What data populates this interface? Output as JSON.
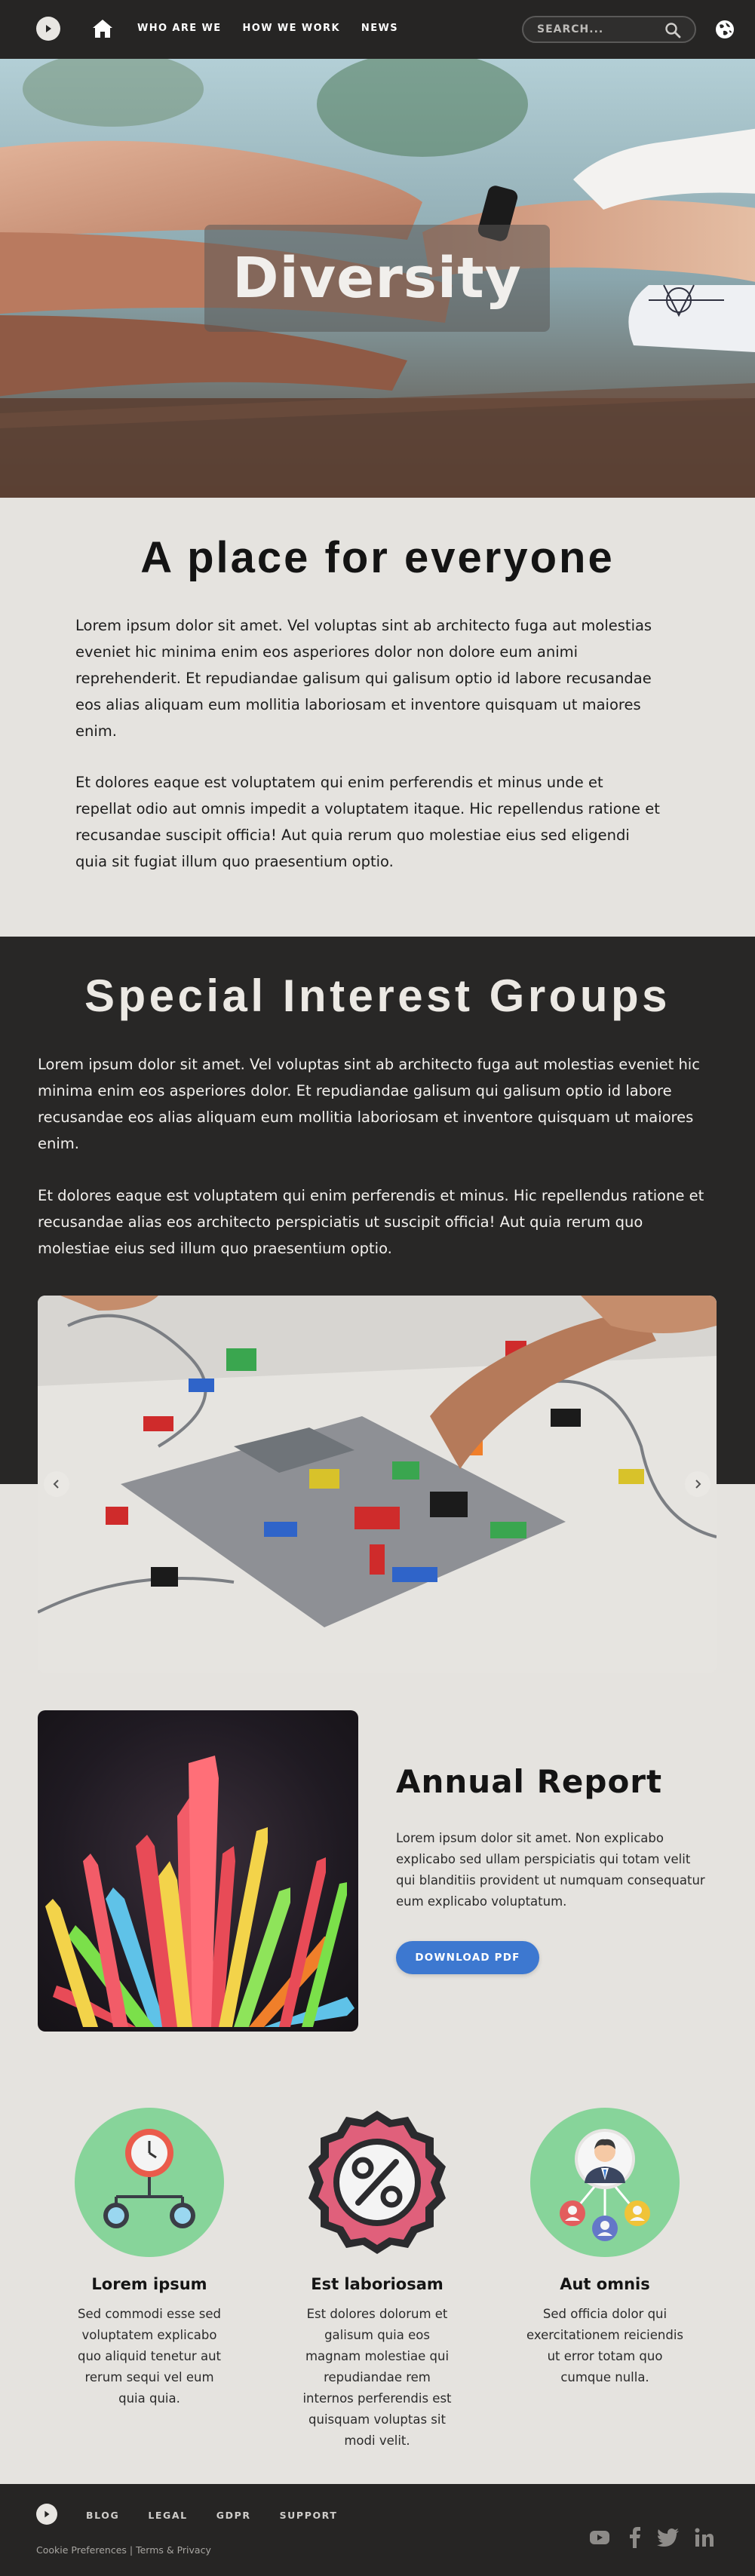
{
  "nav": {
    "links": [
      "WHO ARE WE",
      "HOW WE WORK",
      "NEWS"
    ],
    "search_placeholder": "SEARCH..."
  },
  "hero": {
    "title": "Diversity"
  },
  "intro": {
    "title": "A place for everyone",
    "p1": "Lorem ipsum dolor sit amet. Vel voluptas sint ab architecto fuga aut molestias eveniet hic minima enim eos asperiores dolor non dolore eum animi reprehenderit. Et repudiandae galisum qui galisum optio id labore recusandae eos alias aliquam eum mollitia laboriosam et inventore quisquam ut maiores enim.",
    "p2": "Et dolores eaque est voluptatem qui enim perferendis et minus unde et repellat odio aut omnis impedit a voluptatem itaque. Hic repellendus ratione et recusandae suscipit officia! Aut quia rerum quo molestiae eius sed eligendi quia sit fugiat illum quo praesentium optio."
  },
  "groups": {
    "title": "Special Interest Groups",
    "p1": "Lorem ipsum dolor sit amet. Vel voluptas sint ab architecto fuga aut molestias eveniet hic minima enim eos asperiores dolor. Et repudiandae galisum qui galisum optio id labore recusandae eos alias aliquam eum mollitia laboriosam et inventore quisquam ut maiores enim.",
    "p2": "Et dolores eaque est voluptatem qui enim perferendis et minus. Hic repellendus ratione et recusandae alias eos architecto perspiciatis ut suscipit officia! Aut quia rerum quo molestiae eius sed illum quo praesentium optio."
  },
  "report": {
    "title": "Annual Report",
    "text": "Lorem ipsum dolor sit amet. Non explicabo explicabo sed ullam perspiciatis qui totam velit qui blanditiis provident ut numquam consequatur eum explicabo voluptatum.",
    "button": "DOWNLOAD PDF"
  },
  "features": [
    {
      "title": "Lorem ipsum",
      "text": "Sed commodi esse sed voluptatem explicabo quo aliquid tenetur aut rerum sequi vel eum quia quia."
    },
    {
      "title": "Est laboriosam",
      "text": "Est dolores dolorum et galisum quia eos magnam molestiae qui repudiandae rem internos perferendis est quisquam voluptas sit modi velit."
    },
    {
      "title": "Aut omnis",
      "text": "Sed officia dolor qui exercitationem reiciendis ut error totam quo cumque nulla."
    }
  ],
  "footer": {
    "links": [
      "BLOG",
      "LEGAL",
      "GDPR",
      "SUPPORT"
    ],
    "cookie": "Cookie Preferences",
    "separator": " | ",
    "terms": "Terms & Privacy"
  },
  "colors": {
    "dark": "#282726",
    "light": "#e5e3df",
    "accent": "#3d78d0",
    "feature_circle": "#87d49a"
  }
}
